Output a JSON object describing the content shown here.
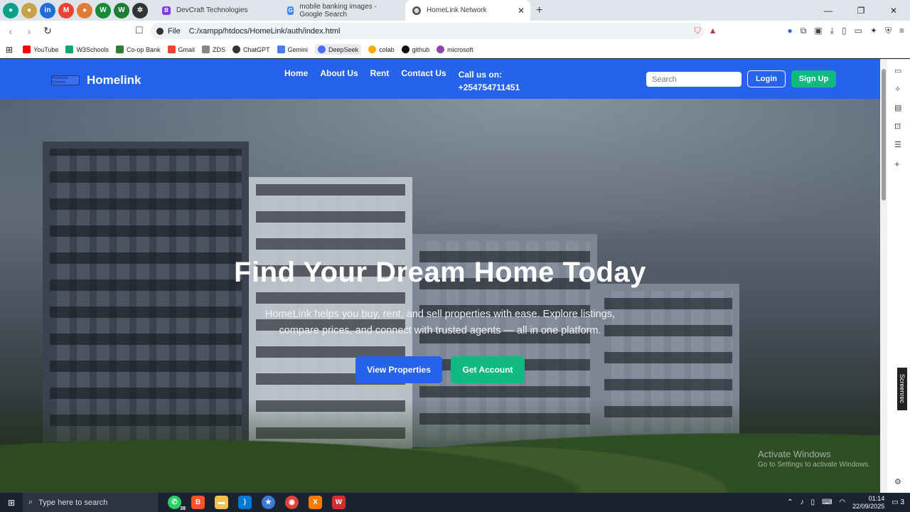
{
  "browser": {
    "tabs": [
      {
        "title": "DevCraft Technologies",
        "active": false
      },
      {
        "title": "mobile banking images - Google Search",
        "active": false
      },
      {
        "title": "HomeLink Network",
        "active": true
      }
    ],
    "url_scheme": "File",
    "url": "C:/xampp/htdocs/HomeLink/auth/index.html",
    "bookmarks": [
      "YouTube",
      "W3Schools",
      "Co-op Bank",
      "Gmail",
      "ZDS",
      "ChatGPT",
      "Gemini",
      "DeepSeek",
      "colab",
      "github",
      "microsoft"
    ]
  },
  "site": {
    "brand": "Homelink",
    "logo_text": "HomeLink Connect",
    "nav": [
      "Home",
      "About Us",
      "Rent",
      "Contact Us"
    ],
    "call_label": "Call us on:",
    "phone": "+254754711451",
    "search_placeholder": "Search",
    "login_label": "Login",
    "signup_label": "Sign Up",
    "hero_title": "Find Your Dream Home Today",
    "hero_subtitle": "HomeLink helps you buy, rent, and sell properties with ease. Explore listings, compare prices, and connect with trusted agents — all in one platform.",
    "view_properties_label": "View Properties",
    "get_account_label": "Get Account"
  },
  "os": {
    "watermark_title": "Activate Windows",
    "watermark_sub": "Go to Settings to activate Windows.",
    "taskbar_search": "Type here to search",
    "whatsapp_badge": "38",
    "time": "01:14",
    "date": "22/09/2025",
    "notification_count": "3",
    "screenrec": "Screenrec"
  },
  "colors": {
    "primary": "#2563eb",
    "accent": "#10b981"
  }
}
